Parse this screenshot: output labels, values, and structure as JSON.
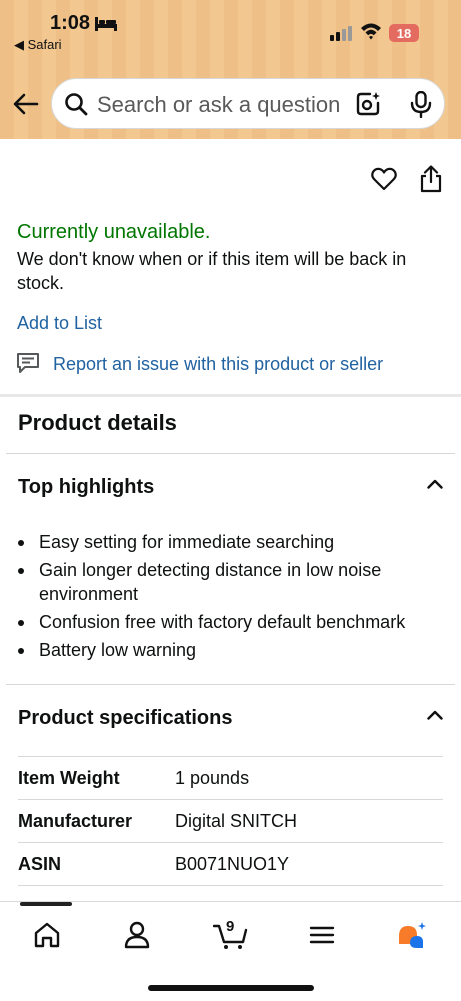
{
  "status_bar": {
    "time": "1:08",
    "back_app": "◀ Safari",
    "battery": "18"
  },
  "search": {
    "placeholder": "Search or ask a question"
  },
  "availability": {
    "status": "Currently unavailable.",
    "message": "We don't know when or if this item will be back in stock."
  },
  "actions": {
    "add_to_list": "Add to List",
    "report": "Report an issue with this product or seller"
  },
  "product_details": {
    "heading": "Product details",
    "top_highlights": {
      "title": "Top highlights",
      "items": [
        "Easy setting for immediate searching",
        "Gain longer detecting distance in low noise environment",
        "Confusion free with factory default benchmark",
        "Battery low warning"
      ]
    },
    "specifications": {
      "title": "Product specifications",
      "rows": [
        {
          "key": "Item Weight",
          "value": "1 pounds"
        },
        {
          "key": "Manufacturer",
          "value": "Digital SNITCH"
        },
        {
          "key": "ASIN",
          "value": "B0071NUO1Y"
        }
      ]
    }
  },
  "bottom_nav": {
    "cart_count": "9",
    "items": [
      "home-icon",
      "account-icon",
      "cart-icon",
      "menu-icon",
      "rufus-icon"
    ]
  },
  "colors": {
    "header_bg": "#f0c38a",
    "available_green": "#007600",
    "link_blue": "#2162a1",
    "rufus_orange": "#f77b28",
    "rufus_blue": "#1a73e8"
  }
}
